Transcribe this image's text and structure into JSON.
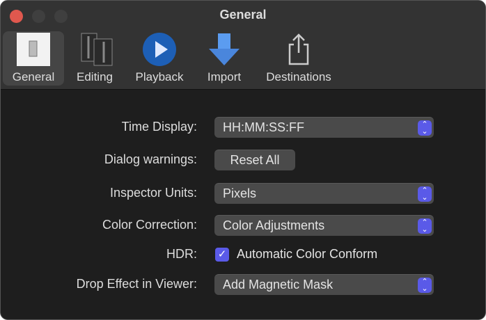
{
  "window": {
    "title": "General"
  },
  "toolbar": [
    {
      "label": "General",
      "icon": "switch-icon",
      "selected": true
    },
    {
      "label": "Editing",
      "icon": "film-strip-icon"
    },
    {
      "label": "Playback",
      "icon": "play-icon"
    },
    {
      "label": "Import",
      "icon": "down-arrow-icon"
    },
    {
      "label": "Destinations",
      "icon": "share-icon"
    }
  ],
  "settings": {
    "time_display": {
      "label": "Time Display:",
      "value": "HH:MM:SS:FF"
    },
    "dialog_warnings": {
      "label": "Dialog warnings:",
      "button": "Reset All"
    },
    "inspector_units": {
      "label": "Inspector Units:",
      "value": "Pixels"
    },
    "color_correction": {
      "label": "Color Correction:",
      "value": "Color Adjustments"
    },
    "hdr": {
      "label": "HDR:",
      "checkbox": "Automatic Color Conform",
      "checked": true
    },
    "drop_effect": {
      "label": "Drop Effect in Viewer:",
      "value": "Add Magnetic Mask"
    }
  },
  "colors": {
    "accent": "#5a5ae8",
    "close": "#e0584e"
  }
}
